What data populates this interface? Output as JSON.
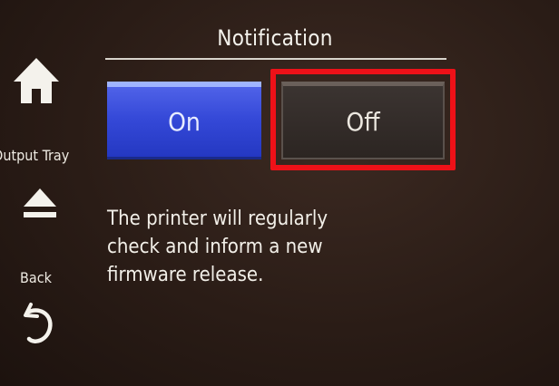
{
  "header": {
    "title": "Notification"
  },
  "sidebar": {
    "home_icon": "home-icon",
    "output_tray_label": "Output Tray",
    "eject_icon": "eject-icon",
    "back_label": "Back",
    "back_icon": "back-arrow-icon"
  },
  "options": [
    {
      "label": "On",
      "state": "selected"
    },
    {
      "label": "Off",
      "state": "highlighted"
    }
  ],
  "message": {
    "lines": [
      "The printer will regularly",
      "check and inform a new",
      "firmware release."
    ]
  },
  "colors": {
    "on_button": "#3549d8",
    "highlight": "#ee1118",
    "background": "#2a1c16"
  }
}
